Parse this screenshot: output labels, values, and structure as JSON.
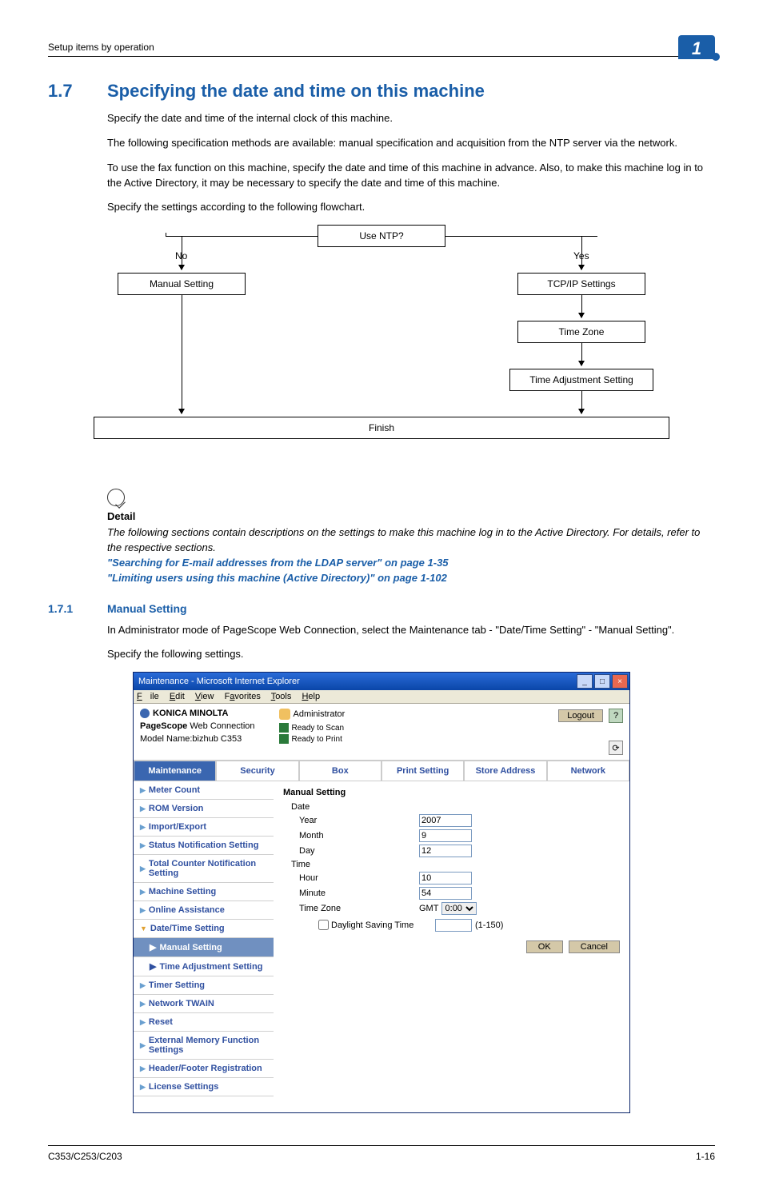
{
  "running_head": "Setup items by operation",
  "chapter_flag": "1",
  "section": {
    "num": "1.7",
    "title": "Specifying the date and time on this machine",
    "paras": [
      "Specify the date and time of the internal clock of this machine.",
      "The following specification methods are available: manual specification and acquisition from the NTP server via the network.",
      "To use the fax function on this machine, specify the date and time of this machine in advance. Also, to make this machine log in to the Active Directory, it may be necessary to specify the date and time of this machine.",
      "Specify the settings according to the following flowchart."
    ]
  },
  "flowchart": {
    "use_ntp": "Use NTP?",
    "no": "No",
    "yes": "Yes",
    "manual": "Manual Setting",
    "tcpip": "TCP/IP Settings",
    "timezone": "Time Zone",
    "timeadj": "Time Adjustment Setting",
    "finish": "Finish"
  },
  "detail": {
    "head": "Detail",
    "body": "The following sections contain descriptions on the settings to make this machine log in to the Active Directory. For details, refer to the respective sections.",
    "link1": "\"Searching for E-mail addresses from the LDAP server\" on page 1-35",
    "link2": "\"Limiting users using this machine (Active Directory)\" on page 1-102"
  },
  "subsection": {
    "num": "1.7.1",
    "title": "Manual Setting",
    "paras": [
      "In Administrator mode of PageScope Web Connection, select the Maintenance tab - \"Date/Time Setting\" - \"Manual Setting\".",
      "Specify the following settings."
    ]
  },
  "ie": {
    "title": "Maintenance - Microsoft Internet Explorer",
    "menus": {
      "file": "File",
      "edit": "Edit",
      "view": "View",
      "fav": "Favorites",
      "tools": "Tools",
      "help": "Help"
    },
    "logo": "KONICA MINOLTA",
    "product_prefix": "PageScope",
    "product": "Web Connection",
    "model": "Model Name:bizhub C353",
    "admin": "Administrator",
    "logout": "Logout",
    "status_scan": "Ready to Scan",
    "status_print": "Ready to Print",
    "tabs": [
      "Maintenance",
      "Security",
      "Box",
      "Print Setting",
      "Store Address",
      "Network"
    ],
    "side": {
      "meter": "Meter Count",
      "rom": "ROM Version",
      "impexp": "Import/Export",
      "statnotif": "Status Notification Setting",
      "totalcnt": "Total Counter Notification Setting",
      "machine": "Machine Setting",
      "online": "Online Assistance",
      "datetime": "Date/Time Setting",
      "manual": "Manual Setting",
      "timeadj": "Time Adjustment Setting",
      "timer": "Timer Setting",
      "twain": "Network TWAIN",
      "reset": "Reset",
      "extmem": "External Memory Function Settings",
      "hdrftr": "Header/Footer Registration",
      "license": "License Settings"
    },
    "form": {
      "title": "Manual Setting",
      "date": "Date",
      "year_l": "Year",
      "year_v": "2007",
      "month_l": "Month",
      "month_v": "9",
      "day_l": "Day",
      "day_v": "12",
      "time": "Time",
      "hour_l": "Hour",
      "hour_v": "10",
      "min_l": "Minute",
      "min_v": "54",
      "tz_l": "Time Zone",
      "tz_prefix": "GMT",
      "tz_v": "0:00",
      "dst": "Daylight Saving Time",
      "dst_range": "(1-150)",
      "ok": "OK",
      "cancel": "Cancel"
    }
  },
  "footer": {
    "left": "C353/C253/C203",
    "right": "1-16"
  }
}
